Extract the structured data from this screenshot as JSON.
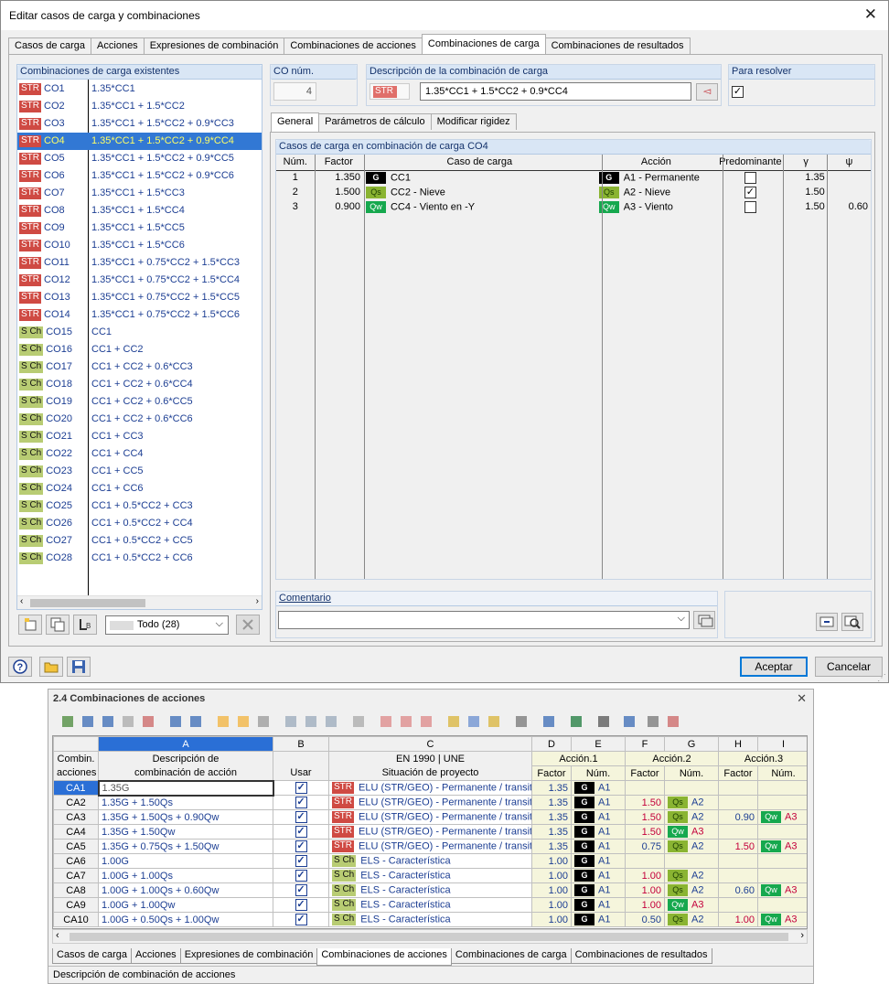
{
  "dialog": {
    "title": "Editar casos de carga y combinaciones",
    "tabs": [
      "Casos de carga",
      "Acciones",
      "Expresiones de combinación",
      "Combinaciones de acciones",
      "Combinaciones de carga",
      "Combinaciones de resultados"
    ],
    "active_tab": "Combinaciones de carga",
    "list_header": "Combinaciones de carga existentes",
    "combinations": [
      {
        "tag": "STR",
        "id": "CO1",
        "desc": "1.35*CC1"
      },
      {
        "tag": "STR",
        "id": "CO2",
        "desc": "1.35*CC1 + 1.5*CC2"
      },
      {
        "tag": "STR",
        "id": "CO3",
        "desc": "1.35*CC1 + 1.5*CC2 + 0.9*CC3"
      },
      {
        "tag": "STR",
        "id": "CO4",
        "desc": "1.35*CC1 + 1.5*CC2 + 0.9*CC4"
      },
      {
        "tag": "STR",
        "id": "CO5",
        "desc": "1.35*CC1 + 1.5*CC2 + 0.9*CC5"
      },
      {
        "tag": "STR",
        "id": "CO6",
        "desc": "1.35*CC1 + 1.5*CC2 + 0.9*CC6"
      },
      {
        "tag": "STR",
        "id": "CO7",
        "desc": "1.35*CC1 + 1.5*CC3"
      },
      {
        "tag": "STR",
        "id": "CO8",
        "desc": "1.35*CC1 + 1.5*CC4"
      },
      {
        "tag": "STR",
        "id": "CO9",
        "desc": "1.35*CC1 + 1.5*CC5"
      },
      {
        "tag": "STR",
        "id": "CO10",
        "desc": "1.35*CC1 + 1.5*CC6"
      },
      {
        "tag": "STR",
        "id": "CO11",
        "desc": "1.35*CC1 + 0.75*CC2 + 1.5*CC3"
      },
      {
        "tag": "STR",
        "id": "CO12",
        "desc": "1.35*CC1 + 0.75*CC2 + 1.5*CC4"
      },
      {
        "tag": "STR",
        "id": "CO13",
        "desc": "1.35*CC1 + 0.75*CC2 + 1.5*CC5"
      },
      {
        "tag": "STR",
        "id": "CO14",
        "desc": "1.35*CC1 + 0.75*CC2 + 1.5*CC6"
      },
      {
        "tag": "S Ch",
        "id": "CO15",
        "desc": "CC1"
      },
      {
        "tag": "S Ch",
        "id": "CO16",
        "desc": "CC1 + CC2"
      },
      {
        "tag": "S Ch",
        "id": "CO17",
        "desc": "CC1 + CC2 + 0.6*CC3"
      },
      {
        "tag": "S Ch",
        "id": "CO18",
        "desc": "CC1 + CC2 + 0.6*CC4"
      },
      {
        "tag": "S Ch",
        "id": "CO19",
        "desc": "CC1 + CC2 + 0.6*CC5"
      },
      {
        "tag": "S Ch",
        "id": "CO20",
        "desc": "CC1 + CC2 + 0.6*CC6"
      },
      {
        "tag": "S Ch",
        "id": "CO21",
        "desc": "CC1 + CC3"
      },
      {
        "tag": "S Ch",
        "id": "CO22",
        "desc": "CC1 + CC4"
      },
      {
        "tag": "S Ch",
        "id": "CO23",
        "desc": "CC1 + CC5"
      },
      {
        "tag": "S Ch",
        "id": "CO24",
        "desc": "CC1 + CC6"
      },
      {
        "tag": "S Ch",
        "id": "CO25",
        "desc": "CC1 + 0.5*CC2 + CC3"
      },
      {
        "tag": "S Ch",
        "id": "CO26",
        "desc": "CC1 + 0.5*CC2 + CC4"
      },
      {
        "tag": "S Ch",
        "id": "CO27",
        "desc": "CC1 + 0.5*CC2 + CC5"
      },
      {
        "tag": "S Ch",
        "id": "CO28",
        "desc": "CC1 + 0.5*CC2 + CC6"
      }
    ],
    "selected_index": 3,
    "filter_value": "Todo (28)",
    "co_num_label": "CO núm.",
    "co_num_value": "4",
    "desc_label": "Descripción de la combinación de carga",
    "desc_tag": "STR",
    "desc_value": "1.35*CC1 + 1.5*CC2 + 0.9*CC4",
    "resolve_label": "Para resolver",
    "resolve_checked": true,
    "subtabs": [
      "General",
      "Parámetros de cálculo",
      "Modificar rigidez"
    ],
    "lc_header": "Casos de carga en combinación de carga CO4",
    "lc_columns": [
      "Núm.",
      "Factor",
      "Caso de carga",
      "Acción",
      "Predominante",
      "γ",
      "ψ"
    ],
    "lc_rows": [
      {
        "num": "1",
        "factor": "1.350",
        "tag": "G",
        "case": "CC1",
        "atag": "G",
        "action": "A1 - Permanente",
        "pred": false,
        "gamma": "1.35",
        "psi": ""
      },
      {
        "num": "2",
        "factor": "1.500",
        "tag": "Qs",
        "case": "CC2 - Nieve",
        "atag": "Qs",
        "action": "A2 - Nieve",
        "pred": true,
        "gamma": "1.50",
        "psi": ""
      },
      {
        "num": "3",
        "factor": "0.900",
        "tag": "Qw",
        "case": "CC4 - Viento en -Y",
        "atag": "Qw",
        "action": "A3 - Viento",
        "pred": false,
        "gamma": "1.50",
        "psi": "0.60"
      }
    ],
    "comment_label": "Comentario",
    "ok": "Aceptar",
    "cancel": "Cancelar"
  },
  "table": {
    "title": "2.4 Combinaciones de acciones",
    "col_letters": [
      "A",
      "B",
      "C",
      "D",
      "E",
      "F",
      "G",
      "H",
      "I"
    ],
    "head1": {
      "row": "Combin.",
      "a": "Descripción de",
      "b": "",
      "c": "EN 1990 | UNE",
      "d": "Acción.1",
      "f": "Acción.2",
      "h": "Acción.3"
    },
    "head2": {
      "row": "acciones",
      "a": "combinación de acción",
      "b": "Usar",
      "c": "Situación de proyecto",
      "factor": "Factor",
      "num": "Núm."
    },
    "rows": [
      {
        "id": "CA1",
        "desc": "1.35G",
        "tag": "STR",
        "sit": "ELU (STR/GEO) - Permanente / transit",
        "f1": "1.35",
        "t1": "G",
        "n1": "A1",
        "f2": "",
        "t2": "",
        "n2": "",
        "f3": "",
        "t3": "",
        "n3": ""
      },
      {
        "id": "CA2",
        "desc": "1.35G + 1.50Qs",
        "tag": "STR",
        "sit": "ELU (STR/GEO) - Permanente / transit",
        "f1": "1.35",
        "t1": "G",
        "n1": "A1",
        "f2": "1.50",
        "t2": "Qs",
        "n2": "A2",
        "f3": "",
        "t3": "",
        "n3": ""
      },
      {
        "id": "CA3",
        "desc": "1.35G + 1.50Qs + 0.90Qw",
        "tag": "STR",
        "sit": "ELU (STR/GEO) - Permanente / transit",
        "f1": "1.35",
        "t1": "G",
        "n1": "A1",
        "f2": "1.50",
        "t2": "Qs",
        "n2": "A2",
        "f3": "0.90",
        "t3": "Qw",
        "n3": "A3"
      },
      {
        "id": "CA4",
        "desc": "1.35G + 1.50Qw",
        "tag": "STR",
        "sit": "ELU (STR/GEO) - Permanente / transit",
        "f1": "1.35",
        "t1": "G",
        "n1": "A1",
        "f2": "1.50",
        "t2": "Qw",
        "n2": "A3",
        "f3": "",
        "t3": "",
        "n3": ""
      },
      {
        "id": "CA5",
        "desc": "1.35G + 0.75Qs + 1.50Qw",
        "tag": "STR",
        "sit": "ELU (STR/GEO) - Permanente / transit",
        "f1": "1.35",
        "t1": "G",
        "n1": "A1",
        "f2": "0.75",
        "t2": "Qs",
        "n2": "A2",
        "f3": "1.50",
        "t3": "Qw",
        "n3": "A3"
      },
      {
        "id": "CA6",
        "desc": "1.00G",
        "tag": "S Ch",
        "sit": "ELS - Característica",
        "f1": "1.00",
        "t1": "G",
        "n1": "A1",
        "f2": "",
        "t2": "",
        "n2": "",
        "f3": "",
        "t3": "",
        "n3": ""
      },
      {
        "id": "CA7",
        "desc": "1.00G + 1.00Qs",
        "tag": "S Ch",
        "sit": "ELS - Característica",
        "f1": "1.00",
        "t1": "G",
        "n1": "A1",
        "f2": "1.00",
        "t2": "Qs",
        "n2": "A2",
        "f3": "",
        "t3": "",
        "n3": ""
      },
      {
        "id": "CA8",
        "desc": "1.00G + 1.00Qs + 0.60Qw",
        "tag": "S Ch",
        "sit": "ELS - Característica",
        "f1": "1.00",
        "t1": "G",
        "n1": "A1",
        "f2": "1.00",
        "t2": "Qs",
        "n2": "A2",
        "f3": "0.60",
        "t3": "Qw",
        "n3": "A3"
      },
      {
        "id": "CA9",
        "desc": "1.00G + 1.00Qw",
        "tag": "S Ch",
        "sit": "ELS - Característica",
        "f1": "1.00",
        "t1": "G",
        "n1": "A1",
        "f2": "1.00",
        "t2": "Qw",
        "n2": "A3",
        "f3": "",
        "t3": "",
        "n3": ""
      },
      {
        "id": "CA10",
        "desc": "1.00G + 0.50Qs + 1.00Qw",
        "tag": "S Ch",
        "sit": "ELS - Característica",
        "f1": "1.00",
        "t1": "G",
        "n1": "A1",
        "f2": "0.50",
        "t2": "Qs",
        "n2": "A2",
        "f3": "1.00",
        "t3": "Qw",
        "n3": "A3"
      }
    ],
    "bottom_tabs": [
      "Casos de carga",
      "Acciones",
      "Expresiones de combinación",
      "Combinaciones de acciones",
      "Combinaciones de carga",
      "Combinaciones de resultados"
    ],
    "active_bottom_tab": "Combinaciones de acciones",
    "status": "Descripción de combinación de acciones"
  }
}
